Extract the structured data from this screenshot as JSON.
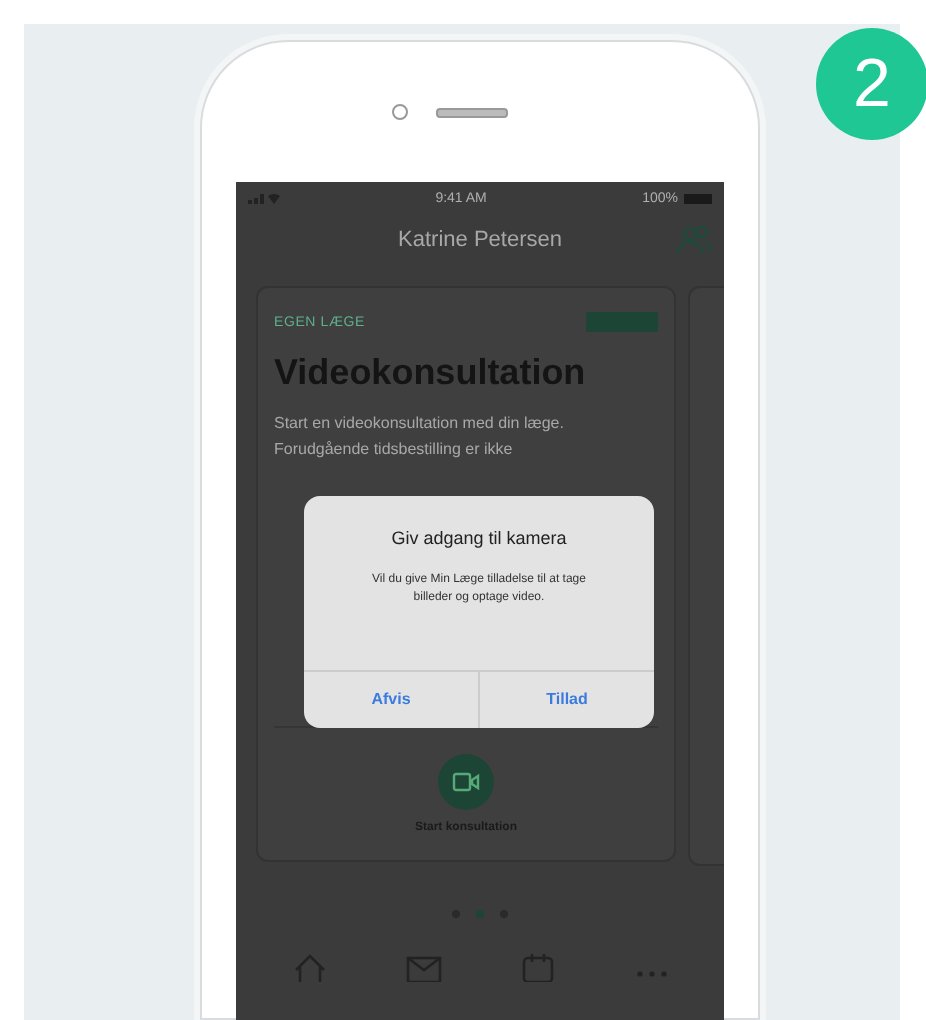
{
  "step_badge": "2",
  "status_bar": {
    "time": "9:41 AM",
    "battery": "100%"
  },
  "header": {
    "title": "Katrine Petersen"
  },
  "card": {
    "label": "EGEN LÆGE",
    "title": "Videokonsultation",
    "text": "Start en videokonsultation med din læge. Forudgående tidsbestilling er ikke",
    "action": "Start konsultation"
  },
  "dialog": {
    "title": "Giv adgang til kamera",
    "message": "Vil du give Min Læge tilladelse til at tage billeder og optage video.",
    "buttons": [
      {
        "label": "Afvis"
      },
      {
        "label": "Tillad"
      }
    ]
  },
  "page_dots": [
    {
      "selected": false
    },
    {
      "selected": true
    },
    {
      "selected": false
    }
  ]
}
